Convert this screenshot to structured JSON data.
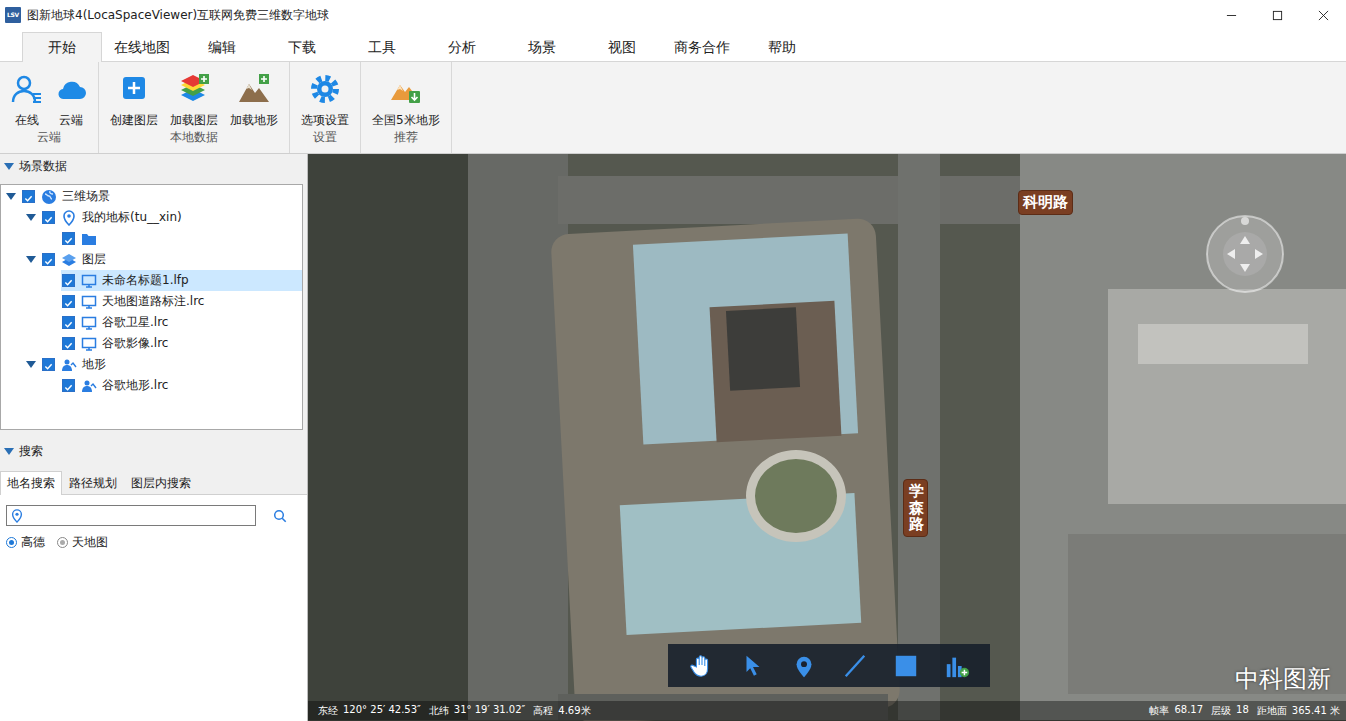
{
  "window": {
    "title": "图新地球4(LocaSpaceViewer)互联网免费三维数字地球",
    "icon_text": "LSV"
  },
  "menu_tabs": [
    {
      "label": "开始",
      "selected": true
    },
    {
      "label": "在线地图",
      "selected": false
    },
    {
      "label": "编辑",
      "selected": false
    },
    {
      "label": "下载",
      "selected": false
    },
    {
      "label": "工具",
      "selected": false
    },
    {
      "label": "分析",
      "selected": false
    },
    {
      "label": "场景",
      "selected": false
    },
    {
      "label": "视图",
      "selected": false
    },
    {
      "label": "商务合作",
      "selected": false
    },
    {
      "label": "帮助",
      "selected": false
    }
  ],
  "ribbon": {
    "groups": [
      {
        "label": "云端",
        "buttons": [
          {
            "label": "在线",
            "kind": "user"
          },
          {
            "label": "云端",
            "kind": "cloud"
          }
        ]
      },
      {
        "label": "本地数据",
        "buttons": [
          {
            "label": "创建图层",
            "kind": "create"
          },
          {
            "label": "加载图层",
            "kind": "layers"
          },
          {
            "label": "加载地形",
            "kind": "terrain"
          }
        ]
      },
      {
        "label": "设置",
        "buttons": [
          {
            "label": "选项设置",
            "kind": "gear"
          }
        ]
      },
      {
        "label": "推荐",
        "buttons": [
          {
            "label": "全国5米地形",
            "kind": "download-terrain"
          }
        ]
      }
    ]
  },
  "scene_panel": {
    "title": "场景数据",
    "expanded": true,
    "tree": [
      {
        "label": "三维场景",
        "kind": "globe",
        "checked": true,
        "expanded": true,
        "selected": false,
        "children": [
          {
            "label": "我的地标(tu__xin)",
            "kind": "pin",
            "checked": true,
            "expanded": true,
            "selected": false,
            "children": [
              {
                "label": "",
                "kind": "folder",
                "checked": true,
                "expanded": false,
                "selected": false,
                "children": []
              }
            ]
          },
          {
            "label": "图层",
            "kind": "layers",
            "checked": true,
            "expanded": true,
            "selected": false,
            "children": [
              {
                "label": "未命名标题1.lfp",
                "kind": "layer",
                "checked": true,
                "expanded": false,
                "selected": true,
                "children": []
              },
              {
                "label": "天地图道路标注.lrc",
                "kind": "layer",
                "checked": true,
                "expanded": false,
                "selected": false,
                "children": []
              },
              {
                "label": "谷歌卫星.lrc",
                "kind": "layer",
                "checked": true,
                "expanded": false,
                "selected": false,
                "children": []
              },
              {
                "label": "谷歌影像.lrc",
                "kind": "layer",
                "checked": true,
                "expanded": false,
                "selected": false,
                "children": []
              }
            ]
          },
          {
            "label": "地形",
            "kind": "terrain",
            "checked": true,
            "expanded": true,
            "selected": false,
            "children": [
              {
                "label": "谷歌地形.lrc",
                "kind": "terrain",
                "checked": true,
                "expanded": false,
                "selected": false,
                "children": []
              }
            ]
          }
        ]
      }
    ]
  },
  "search_panel": {
    "title": "搜索",
    "expanded": true,
    "tabs": [
      {
        "label": "地名搜索",
        "selected": true
      },
      {
        "label": "路径规划",
        "selected": false
      },
      {
        "label": "图层内搜索",
        "selected": false
      }
    ],
    "input": {
      "value": ""
    },
    "providers": [
      {
        "label": "高德",
        "selected": true
      },
      {
        "label": "天地图",
        "selected": false
      }
    ]
  },
  "map": {
    "road_labels": [
      {
        "label": "科明路",
        "vertical": false
      },
      {
        "label": "学森路",
        "vertical": true
      }
    ],
    "watermark": "中科图新",
    "tools": [
      {
        "kind": "pan"
      },
      {
        "kind": "select"
      },
      {
        "kind": "pin"
      },
      {
        "kind": "line"
      },
      {
        "kind": "rect"
      },
      {
        "kind": "chart-add"
      }
    ],
    "status_bar": {
      "left": [
        {
          "label": "东经",
          "value": "120° 25′ 42.53″"
        },
        {
          "label": "北纬",
          "value": "31° 19′ 31.02″"
        },
        {
          "label": "高程",
          "value": "4.69米"
        }
      ],
      "right": [
        {
          "label": "帧率",
          "value": "68.17"
        },
        {
          "label": "层级",
          "value": "18"
        },
        {
          "label": "距地面",
          "value": "365.41 米"
        }
      ]
    }
  }
}
